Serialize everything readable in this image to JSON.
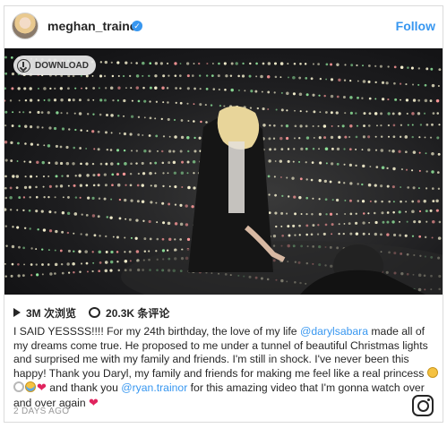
{
  "post": {
    "username": "meghan_trainor",
    "follow_label": "Follow",
    "download_label": "DOWNLOAD",
    "views": "3M 次浏览",
    "comments": "20.3K 条评论",
    "caption": {
      "part1": "I SAID YESSSS!!!! For my 24th birthday, the love of my life ",
      "mention1": "@darylsabara",
      "part2": " made all of my dreams come true. He proposed to me under a tunnel of beautiful Christmas lights and surprised me with my family and friends. I'm still in shock. I've never been this happy! Thank you Daryl, my family and friends for making me feel like a real princess ",
      "part3": " and thank you ",
      "mention2": "@ryan.trainor",
      "part4": " for this amazing video that I'm gonna watch over and over again "
    },
    "timestamp": "2 DAYS AGO"
  },
  "colors": {
    "link": "#3897f0",
    "heart": "#e0245e",
    "verified": "#3897f0"
  },
  "icons": {
    "verified": "verified-badge-icon",
    "download": "download-icon",
    "views": "play-icon",
    "comments": "comment-icon",
    "brand": "instagram-icon",
    "heart": "heart-icon"
  }
}
